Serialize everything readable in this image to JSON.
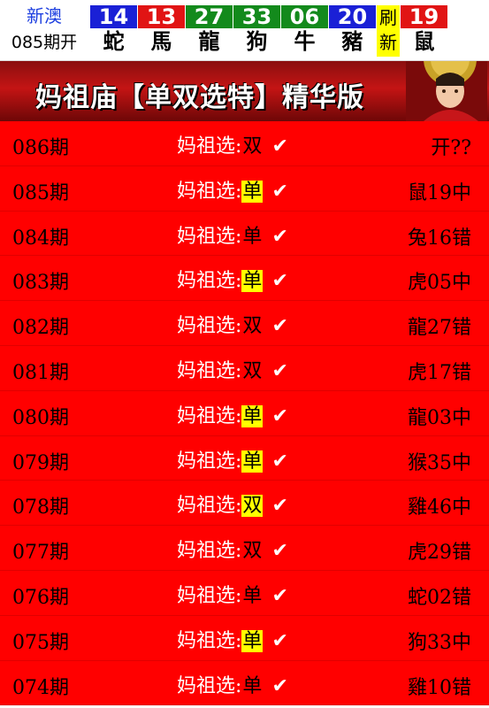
{
  "header": {
    "site_name": "新澳",
    "issue_label": "085期开",
    "balls": [
      {
        "num": "14",
        "zodiac": "蛇",
        "color": "#1a20d6"
      },
      {
        "num": "13",
        "zodiac": "馬",
        "color": "#e11414"
      },
      {
        "num": "27",
        "zodiac": "龍",
        "color": "#138a1c"
      },
      {
        "num": "33",
        "zodiac": "狗",
        "color": "#138a1c"
      },
      {
        "num": "06",
        "zodiac": "牛",
        "color": "#138a1c"
      },
      {
        "num": "20",
        "zodiac": "豬",
        "color": "#1a20d6"
      }
    ],
    "refresh_label": "刷新",
    "special_ball": {
      "num": "19",
      "zodiac": "鼠",
      "color": "#e11414"
    }
  },
  "banner": {
    "title": "妈祖庙【单双选特】精华版"
  },
  "rows": [
    {
      "period": "086期",
      "label": "妈祖选:",
      "pick": "双",
      "highlight": false,
      "result": "开??"
    },
    {
      "period": "085期",
      "label": "妈祖选:",
      "pick": "单",
      "highlight": true,
      "result": "鼠19中"
    },
    {
      "period": "084期",
      "label": "妈祖选:",
      "pick": "单",
      "highlight": false,
      "result": "兔16错"
    },
    {
      "period": "083期",
      "label": "妈祖选:",
      "pick": "单",
      "highlight": true,
      "result": "虎05中"
    },
    {
      "period": "082期",
      "label": "妈祖选:",
      "pick": "双",
      "highlight": false,
      "result": "龍27错"
    },
    {
      "period": "081期",
      "label": "妈祖选:",
      "pick": "双",
      "highlight": false,
      "result": "虎17错"
    },
    {
      "period": "080期",
      "label": "妈祖选:",
      "pick": "单",
      "highlight": true,
      "result": "龍03中"
    },
    {
      "period": "079期",
      "label": "妈祖选:",
      "pick": "单",
      "highlight": true,
      "result": "猴35中"
    },
    {
      "period": "078期",
      "label": "妈祖选:",
      "pick": "双",
      "highlight": true,
      "result": "雞46中"
    },
    {
      "period": "077期",
      "label": "妈祖选:",
      "pick": "双",
      "highlight": false,
      "result": "虎29错"
    },
    {
      "period": "076期",
      "label": "妈祖选:",
      "pick": "单",
      "highlight": false,
      "result": "蛇02错"
    },
    {
      "period": "075期",
      "label": "妈祖选:",
      "pick": "单",
      "highlight": true,
      "result": "狗33中"
    },
    {
      "period": "074期",
      "label": "妈祖选:",
      "pick": "单",
      "highlight": false,
      "result": "雞10错"
    }
  ],
  "check_glyph": "✔"
}
